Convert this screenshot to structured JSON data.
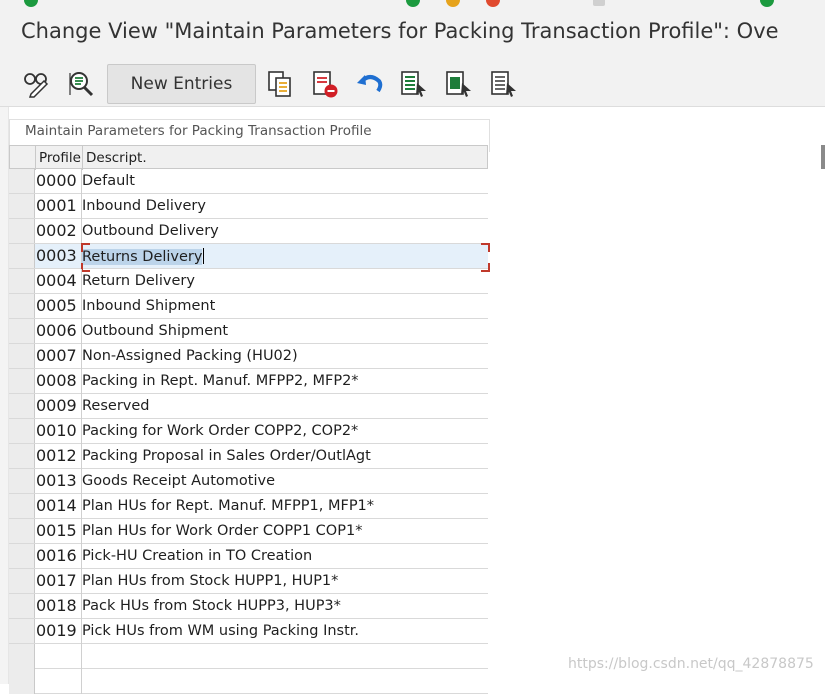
{
  "window": {
    "title": "Change View \"Maintain Parameters for Packing Transaction Profile\": Ove"
  },
  "toolbar": {
    "new_entries_label": "New Entries",
    "icons": [
      "display-change-icon",
      "details-icon",
      "copy-as-icon",
      "delete-icon",
      "undo-icon",
      "select-all-icon",
      "select-block-icon",
      "deselect-all-icon"
    ]
  },
  "panel": {
    "title": "Maintain Parameters for Packing Transaction Profile"
  },
  "table": {
    "columns": [
      "Profile",
      "Descript."
    ],
    "selected_profile": "0003",
    "rows": [
      {
        "profile": "0000",
        "description": "Default"
      },
      {
        "profile": "0001",
        "description": "Inbound Delivery"
      },
      {
        "profile": "0002",
        "description": "Outbound Delivery"
      },
      {
        "profile": "0003",
        "description": "Returns Delivery"
      },
      {
        "profile": "0004",
        "description": "Return Delivery"
      },
      {
        "profile": "0005",
        "description": "Inbound Shipment"
      },
      {
        "profile": "0006",
        "description": "Outbound Shipment"
      },
      {
        "profile": "0007",
        "description": "Non-Assigned Packing (HU02)"
      },
      {
        "profile": "0008",
        "description": "Packing in Rept. Manuf. MFPP2, MFP2*"
      },
      {
        "profile": "0009",
        "description": "Reserved"
      },
      {
        "profile": "0010",
        "description": "Packing for Work Order  COPP2, COP2*"
      },
      {
        "profile": "0012",
        "description": "Packing Proposal in Sales Order/OutlAgt"
      },
      {
        "profile": "0013",
        "description": "Goods Receipt Automotive"
      },
      {
        "profile": "0014",
        "description": "Plan HUs for Rept. Manuf. MFPP1, MFP1*"
      },
      {
        "profile": "0015",
        "description": "Plan HUs for Work Order COPP1 COP1*"
      },
      {
        "profile": "0016",
        "description": "Pick-HU Creation in TO Creation"
      },
      {
        "profile": "0017",
        "description": "Plan HUs from Stock HUPP1, HUP1*"
      },
      {
        "profile": "0018",
        "description": "Pack HUs from Stock HUPP3, HUP3*"
      },
      {
        "profile": "0019",
        "description": "Pick HUs from WM using Packing Instr."
      }
    ]
  },
  "watermark": "https://blog.csdn.net/qq_42878875",
  "colors": {
    "background": "#f2f2f2",
    "selected_row": "#e5f0fa",
    "focus_corner": "#c0392b",
    "icon_green": "#1e7d3a",
    "icon_red": "#d11f26",
    "icon_blue": "#1f6fd1"
  }
}
